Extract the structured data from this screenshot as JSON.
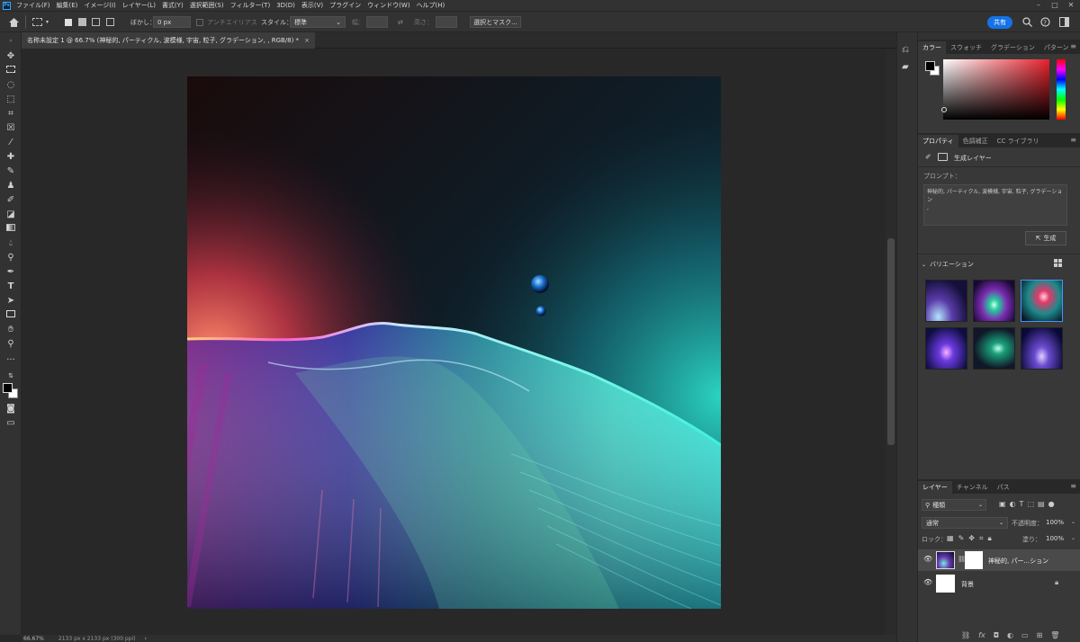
{
  "menubar": {
    "app_icon": "Ps",
    "items": [
      "ファイル(F)",
      "編集(E)",
      "イメージ(I)",
      "レイヤー(L)",
      "書式(Y)",
      "選択範囲(S)",
      "フィルター(T)",
      "3D(D)",
      "表示(V)",
      "プラグイン",
      "ウィンドウ(W)",
      "ヘルプ(H)"
    ],
    "minimize": "–",
    "maximize": "□",
    "close": "✕"
  },
  "options": {
    "feather_label": "ぼかし：",
    "feather_value": "0 px",
    "antialias_label": "アンチエイリアス",
    "style_label": "スタイル：",
    "style_value": "標準",
    "width_label": "幅：",
    "height_label": "高さ：",
    "select_mask_button": "選択とマスク...",
    "share_button": "共有"
  },
  "document": {
    "tab_title": "名称未設定 1 @ 66.7% (神秘的, パーティクル, 波模様, 宇宙, 粒子, グラデーション, , RGB/8) *",
    "close_icon": "×"
  },
  "status": {
    "zoom": "66.67%",
    "dimensions": "2133 px x 2133 px (300 ppi)",
    "arrow": "›"
  },
  "color_panel": {
    "tabs": [
      "カラー",
      "スウォッチ",
      "グラデーション",
      "パターン"
    ],
    "active_tab": 0,
    "hue_color": "#e8212c"
  },
  "properties_panel": {
    "tabs": [
      "プロパティ",
      "色調補正",
      "CC ライブラリ"
    ],
    "active_tab": 0,
    "layer_type": "生成レイヤー",
    "prompt_label": "プロンプト：",
    "prompt_text": "神秘的, パーティクル, 波模様, 宇宙, 粒子, グラデーション\n,",
    "generate_button": "生成",
    "variations_label": "バリエーション"
  },
  "layers_panel": {
    "tabs": [
      "レイヤー",
      "チャンネル",
      "パス"
    ],
    "active_tab": 0,
    "filter_label": "種類",
    "blend_mode": "通常",
    "opacity_label": "不透明度：",
    "opacity_value": "100%",
    "lock_label": "ロック：",
    "fill_label": "塗り：",
    "fill_value": "100%",
    "layers": [
      {
        "name": "神秘的, パー...ション",
        "selected": true
      },
      {
        "name": "背景",
        "selected": false
      }
    ]
  },
  "icons": [
    "home-icon",
    "marquee-icon",
    "move-icon",
    "lasso-icon",
    "crop-icon",
    "eyedropper-icon",
    "brush-icon",
    "stamp-icon",
    "eraser-icon",
    "gradient-icon",
    "text-icon",
    "hand-icon",
    "zoom-icon",
    "search-icon",
    "help-icon",
    "workspace-icon",
    "history-icon",
    "comment-icon",
    "eye-icon",
    "lock-icon",
    "trash-icon"
  ]
}
